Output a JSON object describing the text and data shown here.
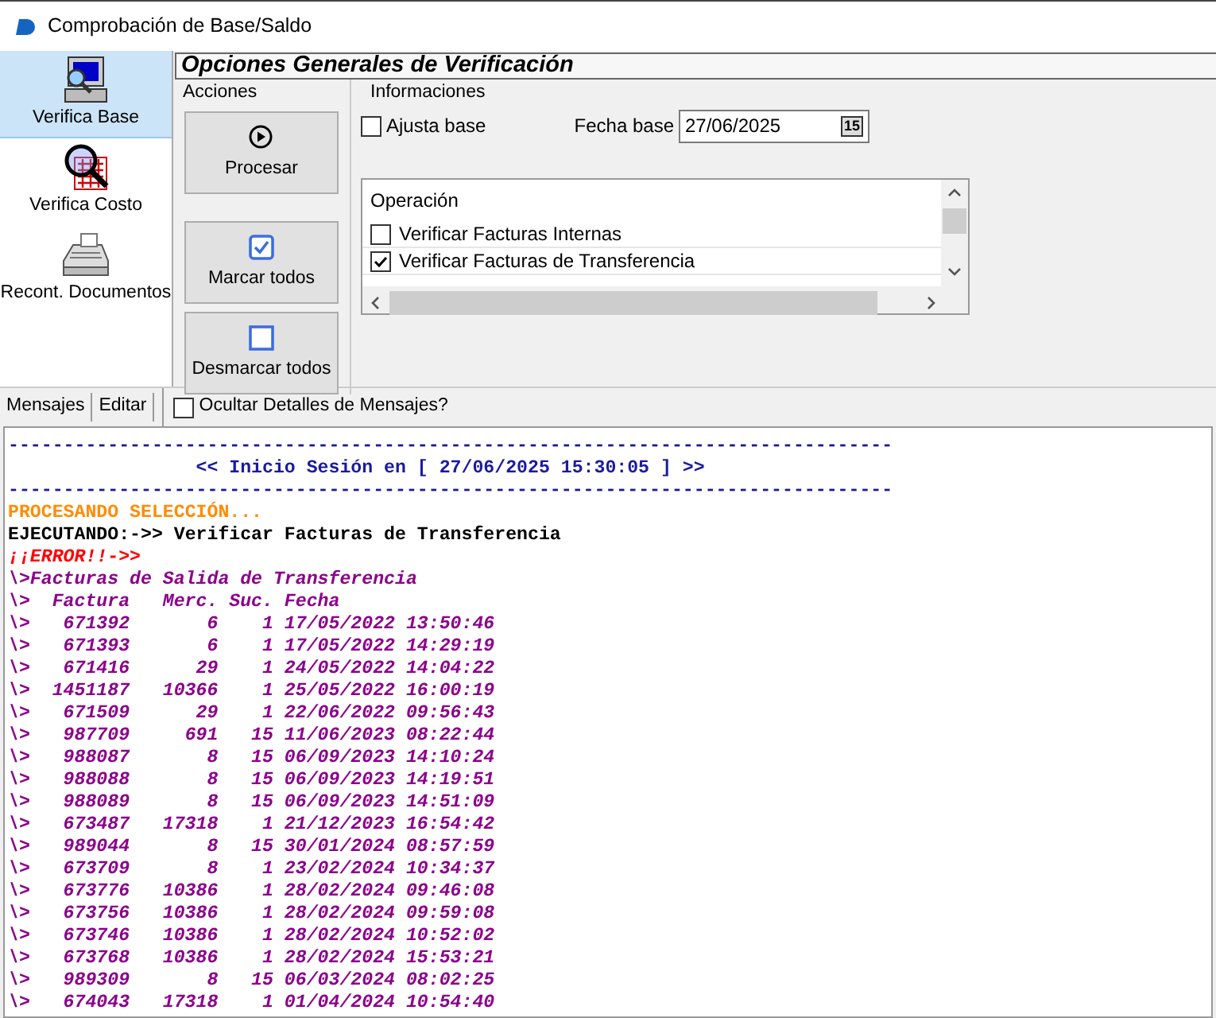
{
  "window": {
    "title": "Comprobación de Base/Saldo"
  },
  "sidebar": {
    "items": [
      {
        "label": "Verifica Base",
        "kind": "monitor",
        "selected": true
      },
      {
        "label": "Verifica Costo",
        "kind": "magnifier",
        "selected": false
      },
      {
        "label": "Recont. Documentos",
        "kind": "register",
        "selected": false
      }
    ]
  },
  "panel_title": "Opciones Generales de Verificación",
  "actions": {
    "title": "Acciones",
    "buttons": [
      {
        "label": "Procesar",
        "kind": "play"
      },
      {
        "label": "Marcar todos",
        "kind": "checked"
      },
      {
        "label": "Desmarcar todos",
        "kind": "unchecked"
      }
    ]
  },
  "info": {
    "title": "Informaciones",
    "adjust": {
      "label": "Ajusta base",
      "checked": false
    },
    "date": {
      "label": "Fecha base",
      "value": "27/06/2025",
      "calendar": "15"
    },
    "operations": {
      "heading": "Operación",
      "items": [
        {
          "label": "Verificar Facturas Internas",
          "checked": false
        },
        {
          "label": "Verificar Facturas de Transferencia",
          "checked": true
        }
      ]
    }
  },
  "toolbar": {
    "menus": [
      "Mensajes",
      "Editar"
    ],
    "hide_details": {
      "label": "Ocultar Detalles de Mensajes?",
      "checked": false
    }
  },
  "log": [
    {
      "kind": "rule",
      "text": "--------------------------------------------------------------------------------"
    },
    {
      "kind": "banner",
      "text": "<< Inicio Sesión en [ 27/06/2025 15:30:05 ] >>"
    },
    {
      "kind": "rule",
      "text": "--------------------------------------------------------------------------------"
    },
    {
      "kind": "status",
      "text": "PROCESANDO SELECCIÓN..."
    },
    {
      "kind": "exec",
      "text": "EJECUTANDO:->> Verificar Facturas de Transferencia"
    },
    {
      "kind": "error",
      "text": "¡¡ERROR!!->>"
    },
    {
      "kind": "section",
      "text": "\\>Facturas de Salida de Transferencia"
    }
  ],
  "table": {
    "prefix": "\\>",
    "columns": [
      "Factura",
      "Merc.",
      "Suc.",
      "Fecha"
    ],
    "rows": [
      [
        "671392",
        "6",
        "1",
        "17/05/2022 13:50:46"
      ],
      [
        "671393",
        "6",
        "1",
        "17/05/2022 14:29:19"
      ],
      [
        "671416",
        "29",
        "1",
        "24/05/2022 14:04:22"
      ],
      [
        "1451187",
        "10366",
        "1",
        "25/05/2022 16:00:19"
      ],
      [
        "671509",
        "29",
        "1",
        "22/06/2022 09:56:43"
      ],
      [
        "987709",
        "691",
        "15",
        "11/06/2023 08:22:44"
      ],
      [
        "988087",
        "8",
        "15",
        "06/09/2023 14:10:24"
      ],
      [
        "988088",
        "8",
        "15",
        "06/09/2023 14:19:51"
      ],
      [
        "988089",
        "8",
        "15",
        "06/09/2023 14:51:09"
      ],
      [
        "673487",
        "17318",
        "1",
        "21/12/2023 16:54:42"
      ],
      [
        "989044",
        "8",
        "15",
        "30/01/2024 08:57:59"
      ],
      [
        "673709",
        "8",
        "1",
        "23/02/2024 10:34:37"
      ],
      [
        "673776",
        "10386",
        "1",
        "28/02/2024 09:46:08"
      ],
      [
        "673756",
        "10386",
        "1",
        "28/02/2024 09:59:08"
      ],
      [
        "673746",
        "10386",
        "1",
        "28/02/2024 10:52:02"
      ],
      [
        "673768",
        "10386",
        "1",
        "28/02/2024 15:53:21"
      ],
      [
        "989309",
        "8",
        "15",
        "06/03/2024 08:02:25"
      ],
      [
        "674043",
        "17318",
        "1",
        "01/04/2024 10:54:40"
      ]
    ]
  }
}
